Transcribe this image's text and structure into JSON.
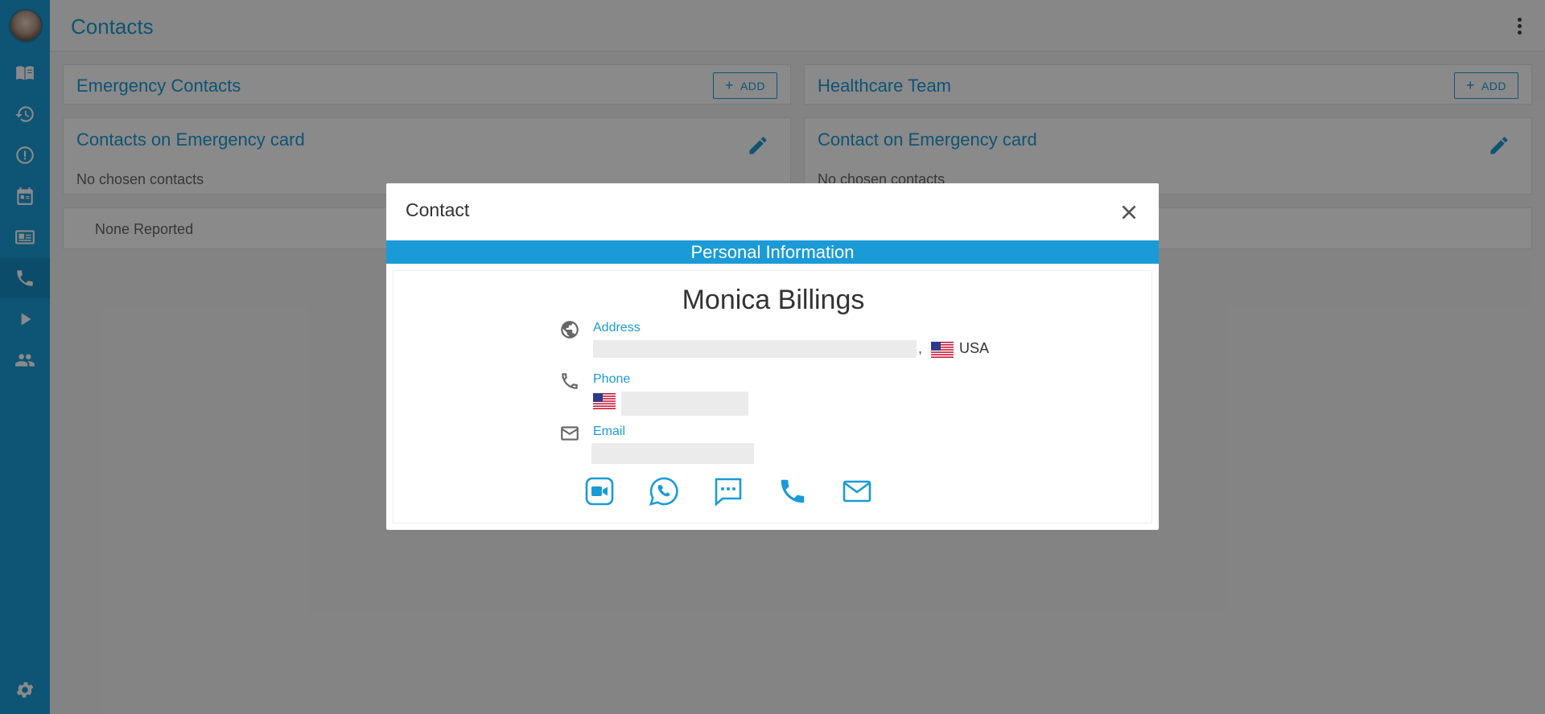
{
  "header": {
    "title": "Contacts"
  },
  "sidebar": {
    "items": [
      {
        "icon": "book-icon"
      },
      {
        "icon": "history-icon"
      },
      {
        "icon": "alert-icon"
      },
      {
        "icon": "calendar-icon"
      },
      {
        "icon": "id-card-icon"
      },
      {
        "icon": "phone-icon",
        "active": true
      },
      {
        "icon": "play-icon"
      },
      {
        "icon": "people-icon"
      },
      {
        "icon": "gear-icon"
      }
    ]
  },
  "cards": {
    "emergency_contacts": {
      "title": "Emergency Contacts",
      "add_label": "ADD"
    },
    "healthcare_team": {
      "title": "Healthcare Team",
      "add_label": "ADD"
    },
    "contacts_on_card_left": {
      "title": "Contacts on Emergency card",
      "empty_text": "No chosen contacts"
    },
    "contacts_on_card_right": {
      "title": "Contact on Emergency card",
      "empty_text": "No chosen contacts"
    },
    "none_reported": {
      "text": "None Reported"
    }
  },
  "modal": {
    "title": "Contact",
    "section": "Personal Information",
    "name": "Monica Billings",
    "address": {
      "label": "Address",
      "separator": ",",
      "country": "USA"
    },
    "phone": {
      "label": "Phone"
    },
    "email": {
      "label": "Email"
    },
    "actions": [
      "video-call-icon",
      "whatsapp-icon",
      "sms-icon",
      "call-icon",
      "email-icon"
    ]
  },
  "colors": {
    "accent": "#1a9bd7",
    "overlay": "rgba(0,0,0,0.46)"
  }
}
